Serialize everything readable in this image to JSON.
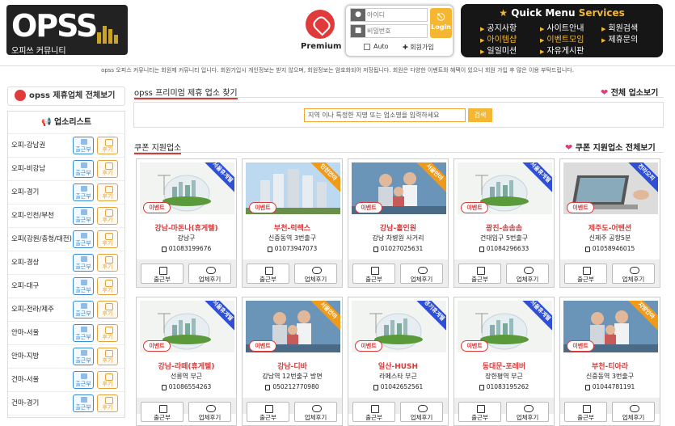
{
  "header": {
    "logo_text": "OPSS",
    "logo_sub": "오피쓰 커뮤니티",
    "premium_label": "Premium",
    "login": {
      "id_placeholder": "아이디",
      "pw_placeholder": "비밀번호",
      "login_button": "Login",
      "auto_label": "Auto",
      "join_label": "회원가입"
    },
    "quick_menu": {
      "title_a": "Quick Menu",
      "title_b": "Services",
      "items": [
        "공지사항",
        "사이트안내",
        "회원검색",
        "아이템샵",
        "이벤트모임",
        "제휴문의",
        "일일미션",
        "자유게시판"
      ]
    }
  },
  "notice": "opss 오피스 커뮤니티는 회원제 커뮤니티 입니다. 회원가입시 개인정보는 받지 않으며, 회원정보는 암호화되어 저장됩니다. 회원은 다양한 이벤트와 혜택이 있으니 회원 가입 후 많은 이용 부탁드립니다.",
  "sidebar": {
    "partner_button": "opss 제휴업체 전체보기",
    "list_title": "업소리스트",
    "btn_attendance": "출근부",
    "btn_review": "후기",
    "regions": [
      "오피-강남권",
      "오피-비강남",
      "오피-경기",
      "오피-인천/부천",
      "오피(강원/충청/대전)",
      "오피-경상",
      "오피-대구",
      "오피-전라/제주",
      "안마-서울",
      "안마-지방",
      "건마-서울",
      "건마-경기"
    ]
  },
  "premium_section": {
    "title": "opss 프리미엄 제휴 업소 찾기",
    "link": "전체 업소보기",
    "search_placeholder": "지역 이나 특정한 지명 또는 업소명을 입력하세요",
    "search_button": "검색"
  },
  "coupon_section": {
    "title": "쿠폰 지원업소",
    "link": "쿠폰 지원업소 전체보기",
    "event_badge": "이벤트",
    "btn_attendance": "출근부",
    "btn_review": "업체후기",
    "cards": [
      {
        "ribbon": "서울휴게텔",
        "ribbon_color": "#2f4fd6",
        "image": "globe",
        "title": "강남-마돈나(휴게텔)",
        "location": "강남구",
        "phone": "01083199676"
      },
      {
        "ribbon": "인천안마",
        "ribbon_color": "#f09a1a",
        "image": "city",
        "title": "부천-럭렉스",
        "location": "신중동역 3번출구",
        "phone": "01073947073"
      },
      {
        "ribbon": "서울안마",
        "ribbon_color": "#f09a1a",
        "image": "family",
        "title": "강남-홀인원",
        "location": "강남 차병원 사거리",
        "phone": "01027025631"
      },
      {
        "ribbon": "서울휴게텔",
        "ribbon_color": "#2f4fd6",
        "image": "globe",
        "title": "광진-솜솜솜",
        "location": "건대입구 5번출구",
        "phone": "01084296633"
      },
      {
        "ribbon": "전라오피",
        "ribbon_color": "#2f4fd6",
        "image": "laptop",
        "title": "제주도-어텐션",
        "location": "신제주 공항5분",
        "phone": "01058946015"
      },
      {
        "ribbon": "서울휴게텔",
        "ribbon_color": "#2f4fd6",
        "image": "globe",
        "title": "강남-라떼(휴게텔)",
        "location": "선릉역 부근",
        "phone": "01086554263"
      },
      {
        "ribbon": "서울안마",
        "ribbon_color": "#f09a1a",
        "image": "family",
        "title": "강남-디바",
        "location": "강남역 12번출구 방면",
        "phone": "050212770980"
      },
      {
        "ribbon": "경기휴게텔",
        "ribbon_color": "#2f4fd6",
        "image": "globe",
        "title": "일산-HUSH",
        "location": "라페스타 부근",
        "phone": "01042652561"
      },
      {
        "ribbon": "서울휴게텔",
        "ribbon_color": "#2f4fd6",
        "image": "globe",
        "title": "동대문-포레버",
        "location": "장한평역 부근",
        "phone": "01083195262"
      },
      {
        "ribbon": "지방안마",
        "ribbon_color": "#f09a1a",
        "image": "family",
        "title": "부천-티아라",
        "location": "신중동역 3번출구",
        "phone": "01044781191"
      }
    ]
  }
}
